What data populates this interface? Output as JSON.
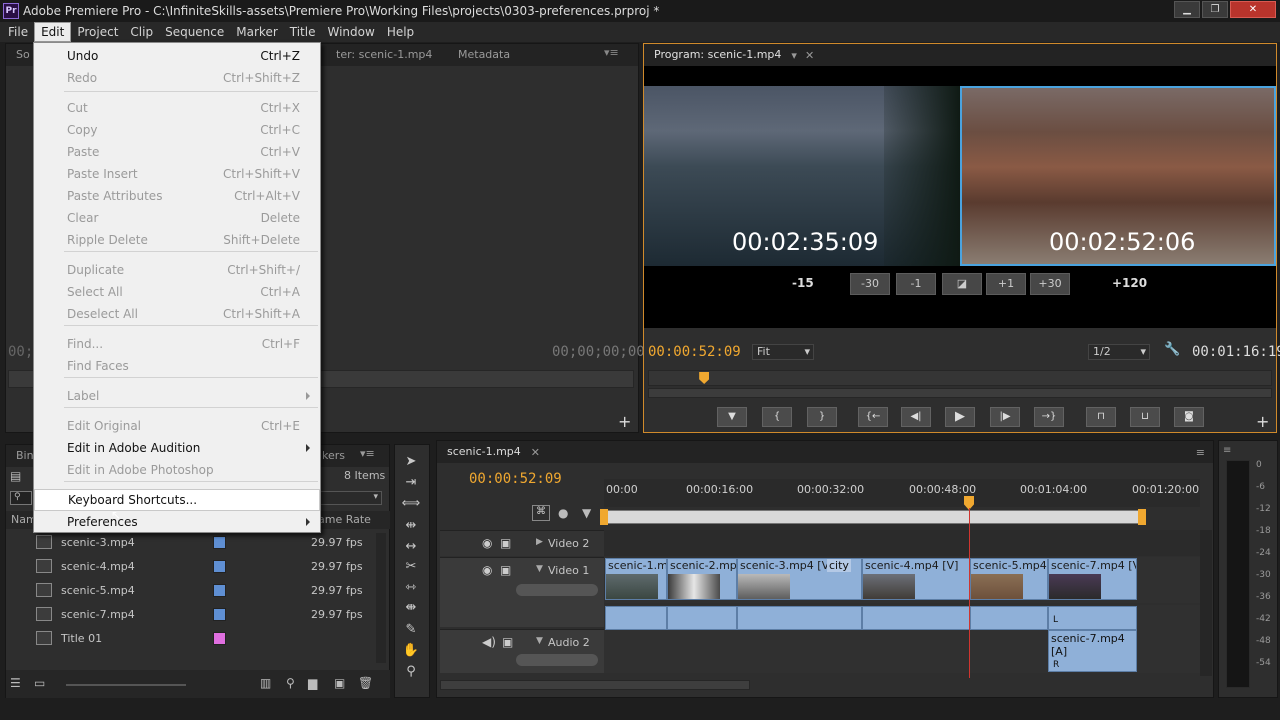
{
  "window": {
    "title": "Adobe Premiere Pro - C:\\InfiniteSkills-assets\\Premiere Pro\\Working Files\\projects\\0303-preferences.prproj *",
    "app_icon": "Pr"
  },
  "menubar": [
    "File",
    "Edit",
    "Project",
    "Clip",
    "Sequence",
    "Marker",
    "Title",
    "Window",
    "Help"
  ],
  "edit_menu": {
    "items": [
      {
        "label": "Undo",
        "shortcut": "Ctrl+Z",
        "enabled": true
      },
      {
        "label": "Redo",
        "shortcut": "Ctrl+Shift+Z",
        "enabled": false
      },
      {
        "label": "Cut",
        "shortcut": "Ctrl+X",
        "enabled": false
      },
      {
        "label": "Copy",
        "shortcut": "Ctrl+C",
        "enabled": false
      },
      {
        "label": "Paste",
        "shortcut": "Ctrl+V",
        "enabled": false
      },
      {
        "label": "Paste Insert",
        "shortcut": "Ctrl+Shift+V",
        "enabled": false
      },
      {
        "label": "Paste Attributes",
        "shortcut": "Ctrl+Alt+V",
        "enabled": false
      },
      {
        "label": "Clear",
        "shortcut": "Delete",
        "enabled": false
      },
      {
        "label": "Ripple Delete",
        "shortcut": "Shift+Delete",
        "enabled": false
      },
      {
        "label": "Duplicate",
        "shortcut": "Ctrl+Shift+/",
        "enabled": false
      },
      {
        "label": "Select All",
        "shortcut": "Ctrl+A",
        "enabled": false
      },
      {
        "label": "Deselect All",
        "shortcut": "Ctrl+Shift+A",
        "enabled": false
      },
      {
        "label": "Find...",
        "shortcut": "Ctrl+F",
        "enabled": false
      },
      {
        "label": "Find Faces",
        "shortcut": "",
        "enabled": false
      },
      {
        "label": "Label",
        "shortcut": "",
        "enabled": false
      },
      {
        "label": "Edit Original",
        "shortcut": "Ctrl+E",
        "enabled": false
      },
      {
        "label": "Edit in Adobe Audition",
        "shortcut": "",
        "enabled": true
      },
      {
        "label": "Edit in Adobe Photoshop",
        "shortcut": "",
        "enabled": false
      },
      {
        "label": "Keyboard Shortcuts...",
        "shortcut": "",
        "enabled": true
      },
      {
        "label": "Preferences",
        "shortcut": "",
        "enabled": true
      }
    ]
  },
  "source_monitor": {
    "tab_partial": "So",
    "tab_source_clip": "ter: scenic-1.mp4",
    "tab_metadata": "Metadata",
    "timecode_left": "00;0",
    "timecode_right": "00;00;00;00"
  },
  "program_monitor": {
    "tab": "Program: scenic-1.mp4",
    "left_timecode": "00:02:35:09",
    "right_timecode": "00:02:52:06",
    "trim_buttons": [
      "-15",
      "-30",
      "-1",
      "+1",
      "+30",
      "+120"
    ],
    "current_timecode": "00:00:52:09",
    "fit": "Fit",
    "resolution": "1/2",
    "duration": "00:01:16:19",
    "playhead_fraction": 0.09
  },
  "project_panel": {
    "tab_bin": "Bin",
    "tab_markers_partial": "kers",
    "item_count": "8 Items",
    "col_name": "Nam",
    "col_frame_rate": "ame Rate",
    "items": [
      {
        "name": "scenic-3.mp4",
        "fps": "29.97 fps",
        "color": "#5f8fd3"
      },
      {
        "name": "scenic-4.mp4",
        "fps": "29.97 fps",
        "color": "#5f8fd3"
      },
      {
        "name": "scenic-5.mp4",
        "fps": "29.97 fps",
        "color": "#5f8fd3"
      },
      {
        "name": "scenic-7.mp4",
        "fps": "29.97 fps",
        "color": "#5f8fd3"
      },
      {
        "name": "Title 01",
        "fps": "",
        "color": "#e06fe0"
      }
    ]
  },
  "timeline": {
    "tab": "scenic-1.mp4",
    "timecode": "00:00:52:09",
    "ruler": [
      "00:00",
      "00:00:16:00",
      "00:00:32:00",
      "00:00:48:00",
      "00:01:04:00",
      "00:01:20:00"
    ],
    "tracks": {
      "video2": "Video 2",
      "video1": "Video 1",
      "audio2": "Audio 2"
    },
    "clips": [
      "scenic-1.mp4",
      "scenic-2.mp4",
      "scenic-3.mp4 [V]",
      "city",
      "scenic-4.mp4 [V]",
      "scenic-5.mp4 [",
      "scenic-7.mp4 [V]"
    ],
    "audio_clip": "scenic-7.mp4 [A]",
    "audio_ch_l": "L",
    "audio_ch_r": "R"
  },
  "audio_meter": {
    "scale": [
      "0",
      "-6",
      "-12",
      "-18",
      "-24",
      "-30",
      "-36",
      "-42",
      "-48",
      "-54"
    ]
  },
  "icons": [
    "search-icon",
    "selection-tool-icon",
    "razor-icon",
    "hand-icon",
    "zoom-icon",
    "wrench-icon",
    "play-icon",
    "camera-icon"
  ]
}
